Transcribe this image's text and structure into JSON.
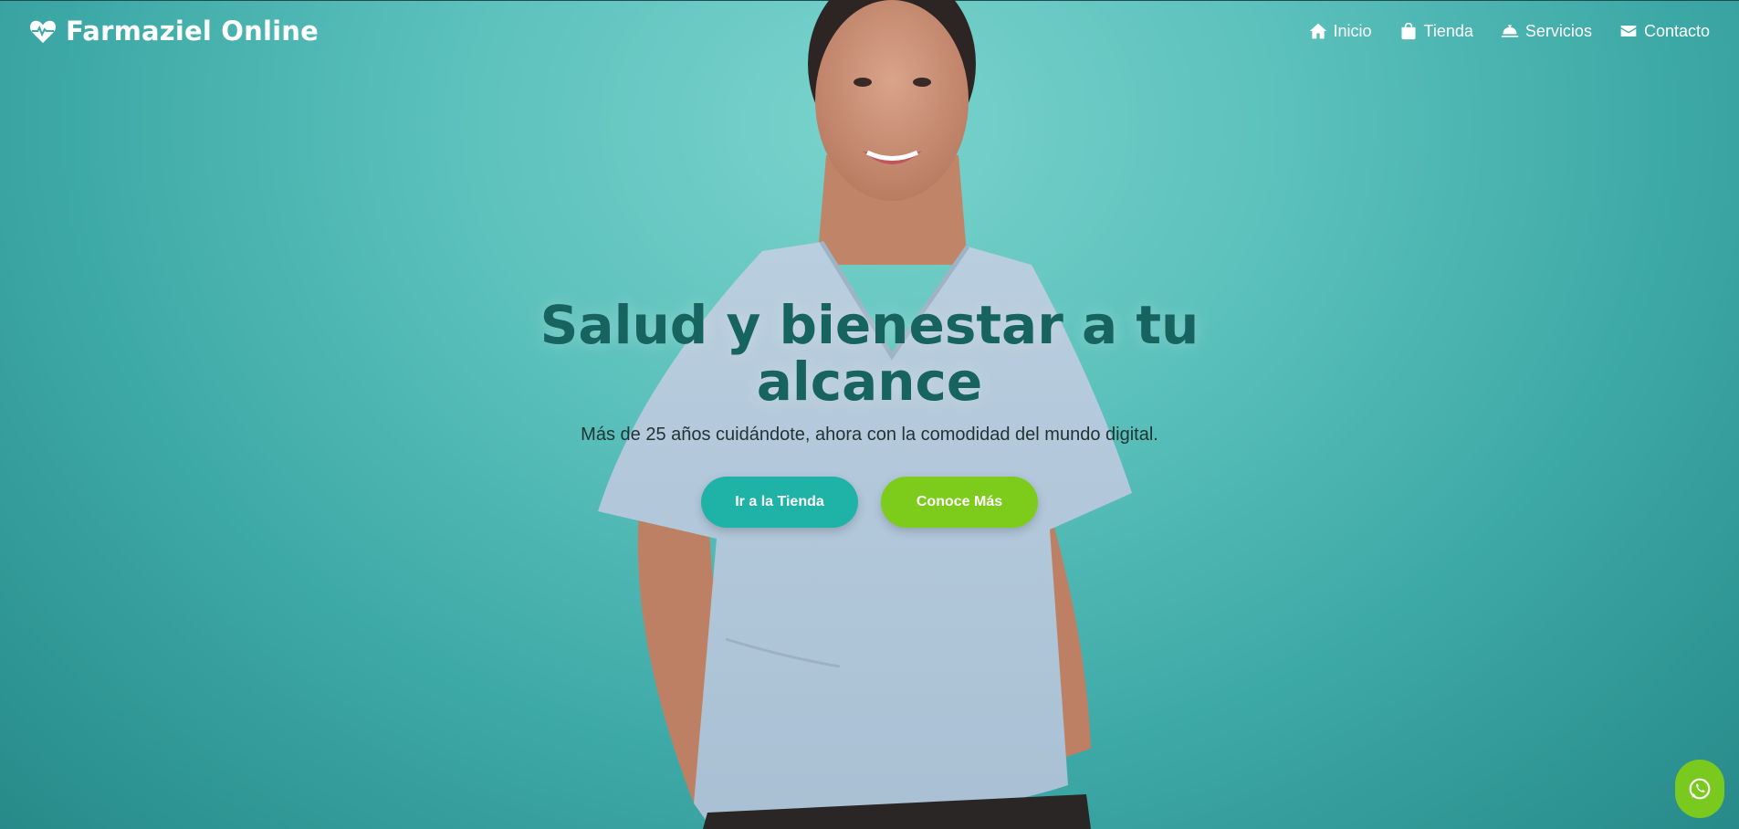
{
  "brand": {
    "name": "Farmaziel Online",
    "icon": "heart-pulse-icon"
  },
  "nav": [
    {
      "label": "Inicio",
      "icon": "home-icon"
    },
    {
      "label": "Tienda",
      "icon": "shopping-bag-icon"
    },
    {
      "label": "Servicios",
      "icon": "bell-service-icon"
    },
    {
      "label": "Contacto",
      "icon": "envelope-icon"
    }
  ],
  "hero": {
    "title": "Salud y bienestar a tu alcance",
    "subtitle": "Más de 25 años cuidándote, ahora con la comodidad del mundo digital.",
    "primary_button": "Ir a la Tienda",
    "secondary_button": "Conoce Más"
  },
  "floating": {
    "icon": "whatsapp-icon"
  },
  "colors": {
    "accent_teal": "#1fb3a8",
    "accent_green": "#7dcc1c",
    "title_color": "#176360",
    "background": "#5bc0bb"
  }
}
